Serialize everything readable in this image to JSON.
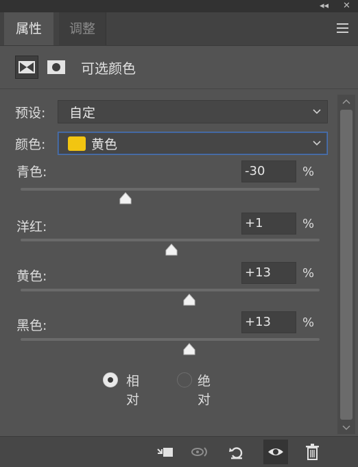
{
  "tabs": {
    "properties": "属性",
    "adjustments": "调整"
  },
  "panel": {
    "title": "可选颜色"
  },
  "preset": {
    "label": "预设:",
    "value": "自定"
  },
  "colors": {
    "label": "颜色:",
    "value": "黄色",
    "swatch": "#f2c511"
  },
  "sliders": [
    {
      "label": "青色:",
      "value": "-30",
      "unit": "%",
      "level": 0.35
    },
    {
      "label": "洋红:",
      "value": "+1",
      "unit": "%",
      "level": 0.505
    },
    {
      "label": "黄色:",
      "value": "+13",
      "unit": "%",
      "level": 0.565
    },
    {
      "label": "黑色:",
      "value": "+13",
      "unit": "%",
      "level": 0.565
    }
  ],
  "method": {
    "relative": "相对",
    "absolute": "绝对",
    "selected": "relative"
  },
  "titlebar": {
    "collapse": "◂◂",
    "close": "✕"
  }
}
